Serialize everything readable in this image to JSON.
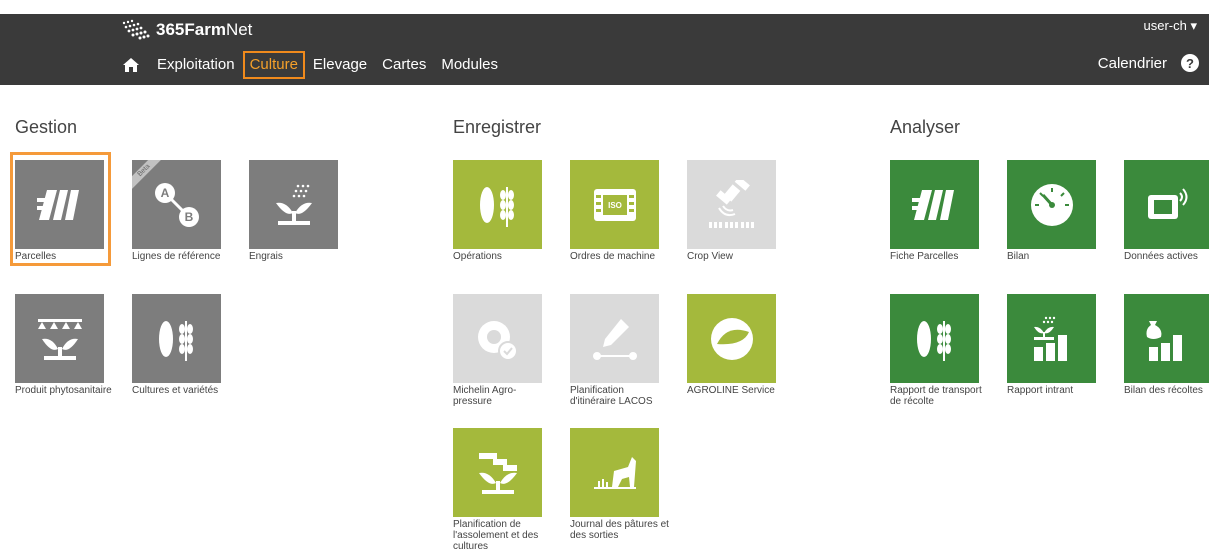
{
  "app": {
    "logo_text_bold": "365Farm",
    "logo_text_light": "Net",
    "user": "user-ch ▾"
  },
  "nav": {
    "items": [
      {
        "label": "Exploitation"
      },
      {
        "label": "Culture"
      },
      {
        "label": "Elevage"
      },
      {
        "label": "Cartes"
      },
      {
        "label": "Modules"
      }
    ],
    "calendar": "Calendrier",
    "help": "?"
  },
  "sections": {
    "gestion": "Gestion",
    "enregistrer": "Enregistrer",
    "analyser": "Analyser"
  },
  "tiles": {
    "parcelles": "Parcelles",
    "lignes": "Lignes de référence",
    "beta": "Beta",
    "engrais": "Engrais",
    "produit": "Produit phytosanitaire",
    "cultures": "Cultures et variétés",
    "operations": "Opérations",
    "ordres": "Ordres de machine",
    "cropview": "Crop View",
    "michelin": "Michelin Agro-pressure",
    "lacos": "Planification d'itinéraire LACOS",
    "agroline": "AGROLINE Service",
    "assolement": "Planification de l'assolement et des cultures",
    "journal": "Journal des pâtures et des sorties",
    "fiche": "Fiche Parcelles",
    "bilan": "Bilan",
    "donnees": "Données actives",
    "rapport_transport": "Rapport de transport de récolte",
    "rapport_intrant": "Rapport intrant",
    "bilan_recoltes": "Bilan des récoltes"
  },
  "colors": {
    "gray": "#7d7d7d",
    "lime": "#a4b93c",
    "green": "#3b8a3c",
    "disabled": "#dadada",
    "highlight": "#f08a1c"
  }
}
